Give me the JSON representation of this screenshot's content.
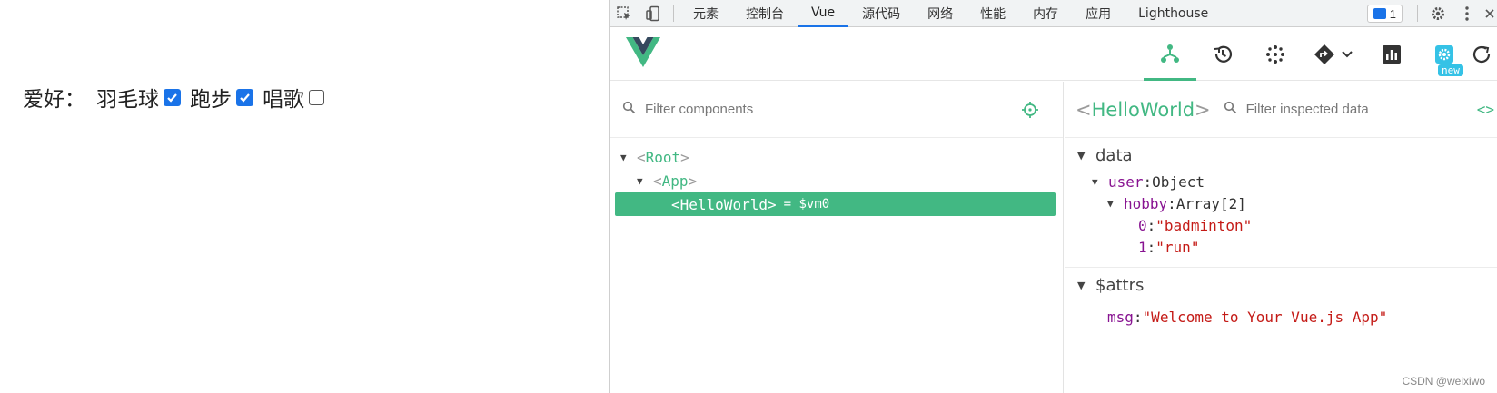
{
  "webpage": {
    "label": "爱好：",
    "options": [
      {
        "text": "羽毛球",
        "checked": true
      },
      {
        "text": "跑步",
        "checked": true
      },
      {
        "text": "唱歌",
        "checked": false
      }
    ]
  },
  "devtools": {
    "tabs": [
      "元素",
      "控制台",
      "Vue",
      "源代码",
      "网络",
      "性能",
      "内存",
      "应用",
      "Lighthouse"
    ],
    "active_tab": "Vue",
    "message_count": "1",
    "accent": "#1a73e8"
  },
  "vue_toolbar": {
    "icons": [
      "components-icon",
      "timeline-icon",
      "plugins-icon",
      "routes-icon",
      "performance-icon",
      "settings-icon",
      "refresh-icon"
    ],
    "new_badge": "new",
    "brand": "#42b883"
  },
  "components": {
    "filter_placeholder": "Filter components",
    "tree": [
      {
        "name": "Root",
        "depth": 0,
        "expanded": true
      },
      {
        "name": "App",
        "depth": 1,
        "expanded": true
      },
      {
        "name": "HelloWorld",
        "depth": 2,
        "selected": true,
        "ref": "= $vm0"
      }
    ]
  },
  "inspector": {
    "lt": "<",
    "gt": ">",
    "component": "HelloWorld",
    "filter_placeholder": "Filter inspected data",
    "code_glyph": "<>",
    "sections": {
      "data": {
        "title": "data",
        "user_key": "user",
        "user_type": "Object",
        "hobby_key": "hobby",
        "hobby_type": "Array[2]",
        "items": [
          {
            "index": "0",
            "value": "\"badminton\""
          },
          {
            "index": "1",
            "value": "\"run\""
          }
        ]
      },
      "attrs": {
        "title": "$attrs",
        "msg_key": "msg",
        "msg_value": "\"Welcome to Your Vue.js App\""
      }
    }
  },
  "watermark": "CSDN @weixiwo"
}
